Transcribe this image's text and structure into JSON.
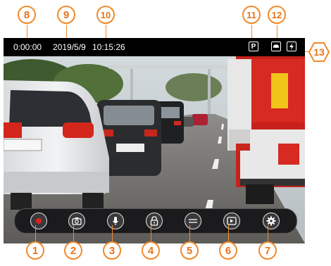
{
  "status_bar": {
    "record_time": "0:00:00",
    "date": "2019/5/9",
    "time": "10:15:26",
    "icons": [
      "parking-mode-icon",
      "car-mode-icon",
      "power-icon"
    ]
  },
  "controls": [
    {
      "name": "record-button",
      "icon": "record-dot-icon"
    },
    {
      "name": "snapshot-button",
      "icon": "camera-icon"
    },
    {
      "name": "microphone-button",
      "icon": "microphone-icon"
    },
    {
      "name": "lock-button",
      "icon": "lock-icon"
    },
    {
      "name": "lane-button",
      "icon": "lane-icon"
    },
    {
      "name": "playback-button",
      "icon": "playback-icon"
    },
    {
      "name": "settings-button",
      "icon": "gear-icon"
    }
  ],
  "callouts": {
    "c1": "1",
    "c2": "2",
    "c3": "3",
    "c4": "4",
    "c5": "5",
    "c6": "6",
    "c7": "7",
    "c8": "8",
    "c9": "9",
    "c10": "10",
    "c11": "11",
    "c12": "12",
    "c13": "13"
  },
  "colors": {
    "accent": "#f08a2a",
    "record": "#e0201f",
    "bar": "#1b1b1d"
  }
}
